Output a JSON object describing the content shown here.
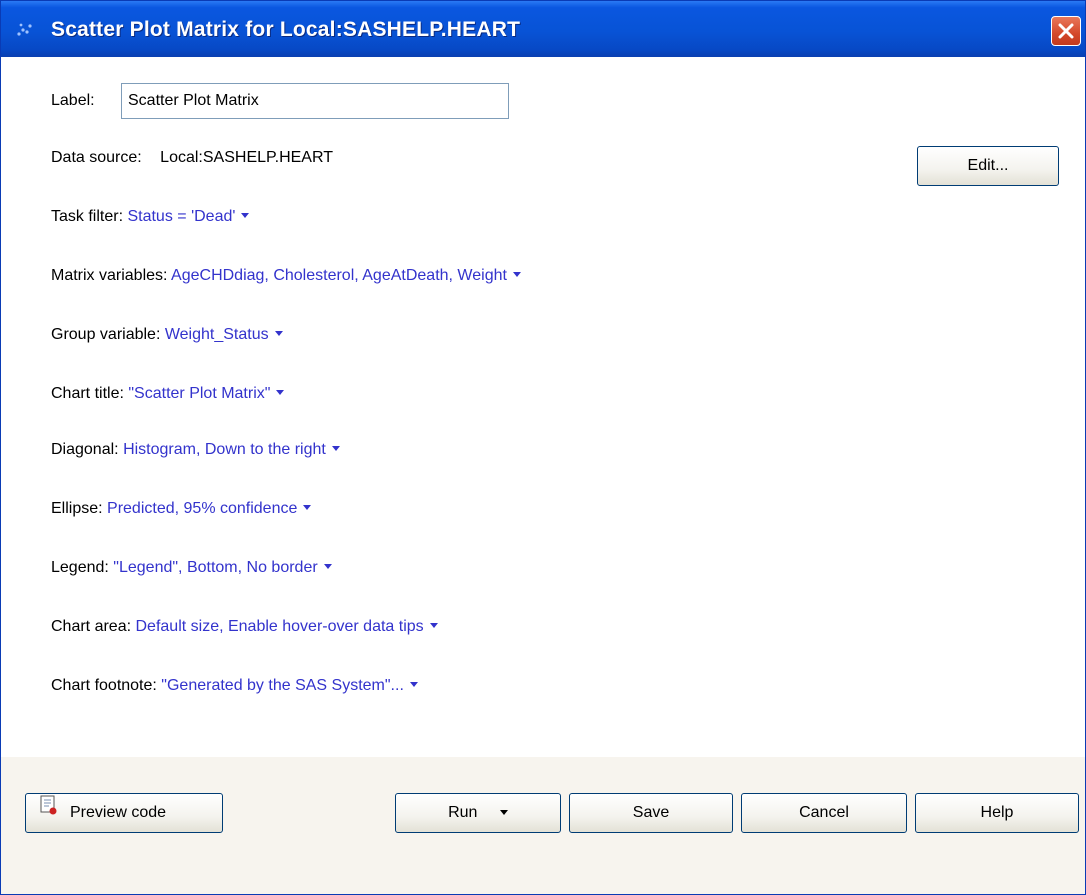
{
  "window": {
    "title": "Scatter Plot Matrix for Local:SASHELP.HEART"
  },
  "form": {
    "label_caption": "Label:",
    "label_value": "Scatter Plot Matrix",
    "datasource_caption": "Data source:",
    "datasource_value": "Local:SASHELP.HEART",
    "edit_button": "Edit...",
    "options": [
      {
        "caption": "Task filter:",
        "value": "Status = 'Dead'"
      },
      {
        "caption": "Matrix variables:",
        "value": "AgeCHDdiag, Cholesterol, AgeAtDeath, Weight"
      },
      {
        "caption": "Group variable:",
        "value": "Weight_Status"
      },
      {
        "caption": "Chart title:",
        "value": "\"Scatter Plot Matrix\""
      },
      {
        "caption": "Diagonal:",
        "value": "Histogram, Down to the right"
      },
      {
        "caption": "Ellipse:",
        "value": "Predicted, 95% confidence"
      },
      {
        "caption": "Legend:",
        "value": "\"Legend\", Bottom, No border"
      },
      {
        "caption": "Chart area:",
        "value": "Default size, Enable hover-over data tips"
      },
      {
        "caption": "Chart footnote:",
        "value": "\"Generated by the SAS System\"..."
      }
    ]
  },
  "buttons": {
    "preview_code": "Preview code",
    "run": "Run",
    "save": "Save",
    "cancel": "Cancel",
    "help": "Help"
  },
  "icons": {
    "app": "scatter-app-icon",
    "close": "close-icon",
    "dropdown": "dropdown-arrow-icon",
    "preview": "document-icon"
  },
  "colors": {
    "titlebar": "#0853d6",
    "link_value": "#3333cc",
    "close_button": "#d4482a"
  }
}
